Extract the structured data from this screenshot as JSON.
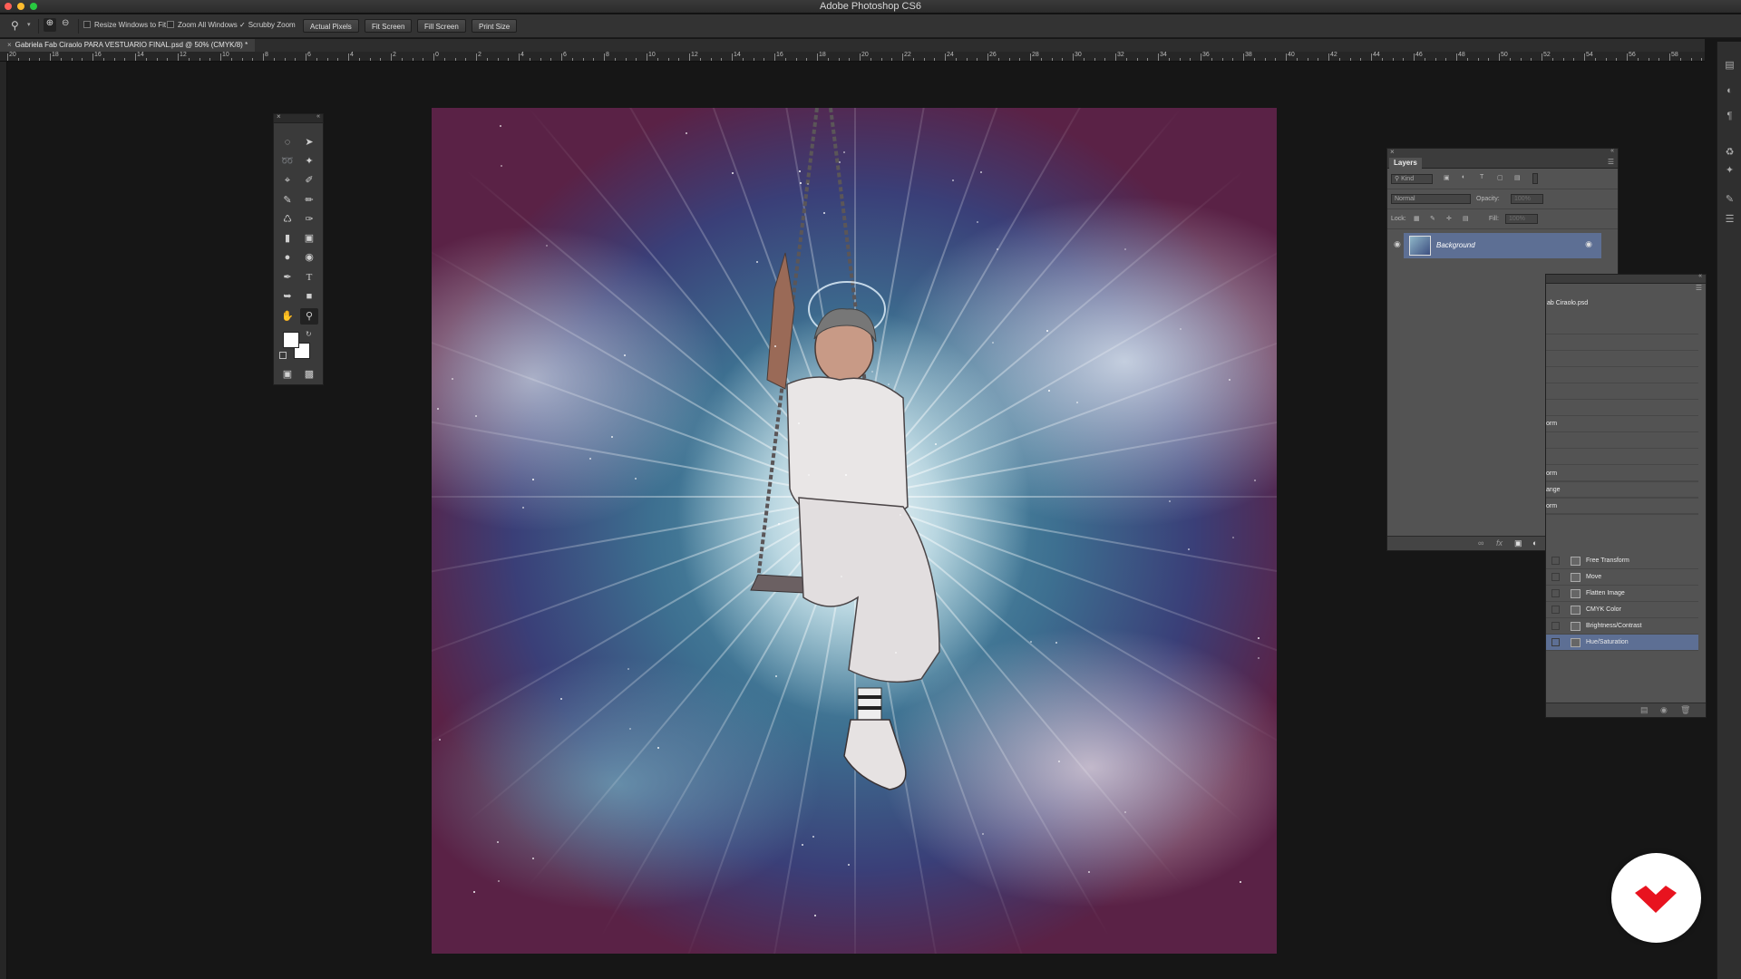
{
  "app": {
    "title": "Adobe Photoshop CS6"
  },
  "options_bar": {
    "resize_windows_label": "Resize Windows to Fit",
    "zoom_all_label": "Zoom All Windows",
    "scrubby_zoom_label": "Scrubby Zoom",
    "actual_pixels": "Actual Pixels",
    "fit_screen": "Fit Screen",
    "fill_screen": "Fill Screen",
    "print_size": "Print Size"
  },
  "document": {
    "tab_title": "Gabriela Fab Ciraolo PARA VESTUARIO FINAL.psd @ 50% (CMYK/8) *"
  },
  "ruler": {
    "labels": [
      "20",
      "18",
      "16",
      "14",
      "12",
      "10",
      "8",
      "6",
      "4",
      "2",
      "0",
      "2",
      "4",
      "6",
      "8",
      "10",
      "12",
      "14",
      "16",
      "18",
      "20",
      "22",
      "24",
      "26",
      "28",
      "30",
      "32",
      "34",
      "36",
      "38",
      "40",
      "42",
      "44",
      "46",
      "48",
      "50",
      "52",
      "54",
      "56",
      "58"
    ]
  },
  "layers_panel": {
    "tab": "Layers",
    "filter_kind": "Kind",
    "blend_mode": "Normal",
    "opacity_label": "Opacity:",
    "opacity_value": "100%",
    "lock_label": "Lock:",
    "fill_label": "Fill:",
    "fill_value": "100%",
    "layer_name": "Background"
  },
  "history_panel": {
    "snapshot_name": "ab Ciraolo.psd",
    "partial_items": [
      "orm",
      "orm",
      "ange",
      "orm"
    ],
    "items": [
      "Free Transform",
      "Move",
      "Flatten Image",
      "CMYK Color",
      "Brightness/Contrast",
      "Hue/Saturation"
    ],
    "selected_index": 5
  },
  "colors": {
    "selection": "#5d6f94",
    "logo_red": "#e8131f"
  },
  "icons": {
    "zoom_tool": "magnifier-icon",
    "hand_tool": "hand-icon",
    "type_tool": "type-icon",
    "visibility": "eye-icon",
    "lock": "lock-icon",
    "brand": "brand-logo"
  }
}
